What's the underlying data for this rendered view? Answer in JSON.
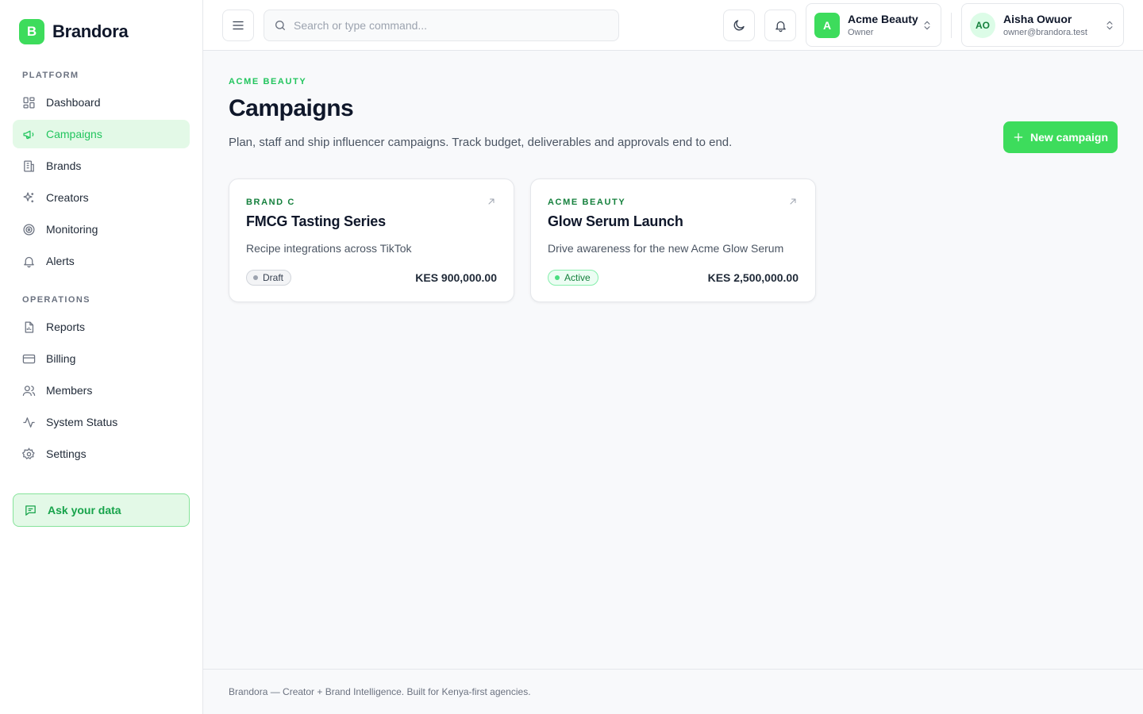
{
  "brand": {
    "initial": "B",
    "name": "Brandora",
    "accent": "#3ddc5c"
  },
  "sidebar": {
    "platform_label": "PLATFORM",
    "operations_label": "OPERATIONS",
    "platform_items": [
      {
        "label": "Dashboard",
        "icon": "dashboard-icon"
      },
      {
        "label": "Campaigns",
        "icon": "megaphone-icon",
        "active": true
      },
      {
        "label": "Brands",
        "icon": "building-icon"
      },
      {
        "label": "Creators",
        "icon": "sparkles-icon"
      },
      {
        "label": "Monitoring",
        "icon": "radar-icon"
      },
      {
        "label": "Alerts",
        "icon": "bell-icon"
      }
    ],
    "operations_items": [
      {
        "label": "Reports",
        "icon": "report-icon"
      },
      {
        "label": "Billing",
        "icon": "credit-card-icon"
      },
      {
        "label": "Members",
        "icon": "users-icon"
      },
      {
        "label": "System Status",
        "icon": "activity-icon"
      },
      {
        "label": "Settings",
        "icon": "gear-icon"
      }
    ],
    "ask_label": "Ask your data"
  },
  "topbar": {
    "search_placeholder": "Search or type command...",
    "org": {
      "initial": "A",
      "name": "Acme Beauty",
      "role": "Owner"
    },
    "user": {
      "initials": "AO",
      "name": "Aisha Owuor",
      "email": "owner@brandora.test"
    }
  },
  "page": {
    "eyebrow": "ACME BEAUTY",
    "title": "Campaigns",
    "description": "Plan, staff and ship influencer campaigns. Track budget, deliverables and approvals end to end.",
    "new_button_label": "New campaign"
  },
  "campaigns": [
    {
      "brand": "BRAND C",
      "title": "FMCG Tasting Series",
      "description": "Recipe integrations across TikTok",
      "status": "Draft",
      "budget": "KES 900,000.00"
    },
    {
      "brand": "ACME BEAUTY",
      "title": "Glow Serum Launch",
      "description": "Drive awareness for the new Acme Glow Serum",
      "status": "Active",
      "budget": "KES 2,500,000.00"
    }
  ],
  "footer": {
    "text": "Brandora — Creator + Brand Intelligence. Built for Kenya-first agencies."
  }
}
